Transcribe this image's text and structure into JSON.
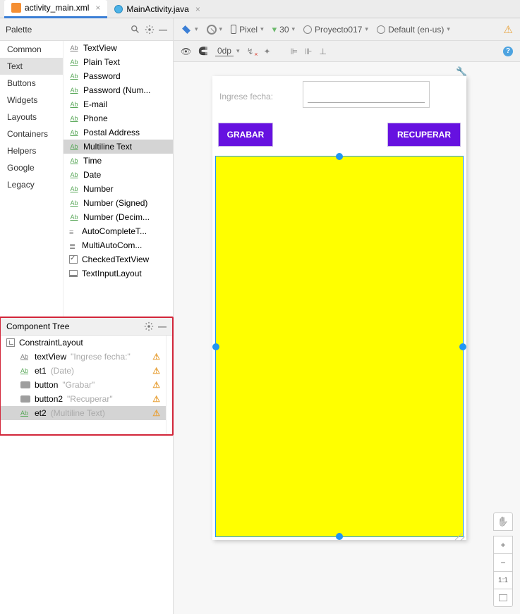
{
  "tabs": [
    {
      "label": "activity_main.xml",
      "active": true
    },
    {
      "label": "MainActivity.java",
      "active": false
    }
  ],
  "palette": {
    "title": "Palette",
    "categories": [
      "Common",
      "Text",
      "Buttons",
      "Widgets",
      "Layouts",
      "Containers",
      "Helpers",
      "Google",
      "Legacy"
    ],
    "selected_category": "Text",
    "items": [
      {
        "label": "TextView",
        "icon": "ab"
      },
      {
        "label": "Plain Text",
        "icon": "ab-green"
      },
      {
        "label": "Password",
        "icon": "ab-green"
      },
      {
        "label": "Password (Num...",
        "icon": "ab-green"
      },
      {
        "label": "E-mail",
        "icon": "ab-green"
      },
      {
        "label": "Phone",
        "icon": "ab-green"
      },
      {
        "label": "Postal Address",
        "icon": "ab-green"
      },
      {
        "label": "Multiline Text",
        "icon": "ab-green",
        "selected": true
      },
      {
        "label": "Time",
        "icon": "ab-green"
      },
      {
        "label": "Date",
        "icon": "ab-green"
      },
      {
        "label": "Number",
        "icon": "ab-green"
      },
      {
        "label": "Number (Signed)",
        "icon": "ab-green"
      },
      {
        "label": "Number (Decim...",
        "icon": "ab-green"
      },
      {
        "label": "AutoCompleteT...",
        "icon": "auto"
      },
      {
        "label": "MultiAutoCom...",
        "icon": "multi"
      },
      {
        "label": "CheckedTextView",
        "icon": "check"
      },
      {
        "label": "TextInputLayout",
        "icon": "layout"
      }
    ]
  },
  "component_tree": {
    "title": "Component Tree",
    "root": "ConstraintLayout",
    "items": [
      {
        "name": "textView",
        "hint": "\"Ingrese fecha:\"",
        "icon": "ab",
        "warn": true
      },
      {
        "name": "et1",
        "hint": "(Date)",
        "icon": "ab-green",
        "warn": true
      },
      {
        "name": "button",
        "hint": "\"Grabar\"",
        "icon": "btn",
        "warn": true
      },
      {
        "name": "button2",
        "hint": "\"Recuperar\"",
        "icon": "btn",
        "warn": true
      },
      {
        "name": "et2",
        "hint": "(Multiline Text)",
        "icon": "ab-green",
        "warn": true,
        "selected": true
      }
    ]
  },
  "toolbar": {
    "device": "Pixel",
    "api": "30",
    "app": "Proyecto017",
    "locale": "Default (en-us)",
    "margin": "0dp"
  },
  "preview": {
    "label": "Ingrese fecha:",
    "btn1": "GRABAR",
    "btn2": "RECUPERAR"
  },
  "zoom": {
    "plus": "+",
    "minus": "−",
    "ratio": "1:1"
  }
}
